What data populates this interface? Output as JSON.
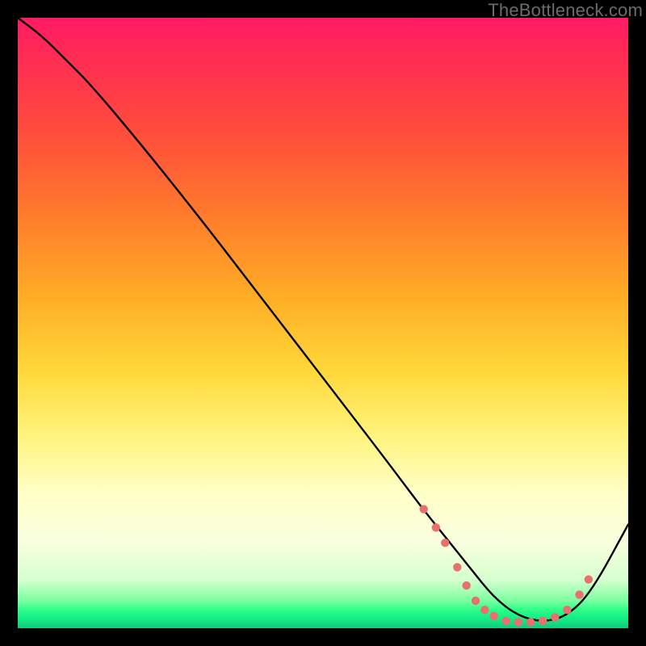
{
  "watermark": "TheBottleneck.com",
  "chart_data": {
    "type": "line",
    "title": "",
    "xlabel": "",
    "ylabel": "",
    "xlim": [
      0,
      100
    ],
    "ylim": [
      0,
      100
    ],
    "grid": false,
    "legend": false,
    "series": [
      {
        "name": "curve",
        "x": [
          0,
          4,
          8,
          12,
          20,
          30,
          40,
          50,
          60,
          66,
          70,
          74,
          78,
          82,
          86,
          90,
          94,
          100
        ],
        "y": [
          100,
          97,
          93,
          89,
          79.5,
          67,
          54,
          41,
          28,
          20,
          15,
          10,
          5,
          2,
          1,
          2,
          6,
          17
        ],
        "color": "#000000",
        "stroke_width": 2.4
      }
    ],
    "markers": {
      "name": "dots-near-minimum",
      "color": "#e8706e",
      "radius": 5.2,
      "points_xy": [
        [
          66.5,
          19.5
        ],
        [
          68.5,
          16.5
        ],
        [
          70.0,
          14.0
        ],
        [
          72.0,
          10.0
        ],
        [
          73.5,
          7.0
        ],
        [
          75.0,
          4.5
        ],
        [
          76.5,
          3.0
        ],
        [
          78.0,
          2.0
        ],
        [
          80.0,
          1.2
        ],
        [
          82.0,
          1.0
        ],
        [
          84.0,
          1.0
        ],
        [
          86.0,
          1.2
        ],
        [
          88.0,
          1.8
        ],
        [
          90.0,
          3.0
        ],
        [
          92.0,
          5.5
        ],
        [
          93.5,
          8.0
        ]
      ]
    },
    "background_gradient": {
      "direction": "top-to-bottom",
      "stops": [
        {
          "pos": 0.0,
          "color": "#ff1a66"
        },
        {
          "pos": 0.18,
          "color": "#ff4a3d"
        },
        {
          "pos": 0.46,
          "color": "#ffae26"
        },
        {
          "pos": 0.68,
          "color": "#fff37a"
        },
        {
          "pos": 0.86,
          "color": "#f9ffde"
        },
        {
          "pos": 0.97,
          "color": "#2bff88"
        },
        {
          "pos": 1.0,
          "color": "#11c97a"
        }
      ]
    }
  }
}
